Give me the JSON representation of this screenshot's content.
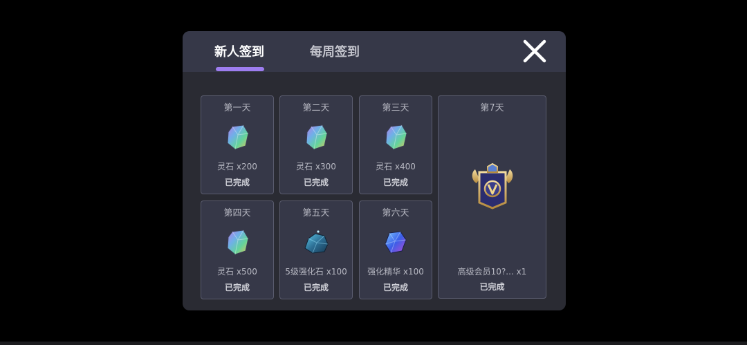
{
  "tabs": [
    {
      "label": "新人签到",
      "active": true
    },
    {
      "label": "每周签到",
      "active": false
    }
  ],
  "days": [
    {
      "title": "第一天",
      "reward": "灵石 x200",
      "status": "已完成",
      "icon": "rainbow-crystal-icon"
    },
    {
      "title": "第二天",
      "reward": "灵石 x300",
      "status": "已完成",
      "icon": "rainbow-crystal-icon"
    },
    {
      "title": "第三天",
      "reward": "灵石 x400",
      "status": "已完成",
      "icon": "rainbow-crystal-icon"
    },
    {
      "title": "第四天",
      "reward": "灵石 x500",
      "status": "已完成",
      "icon": "rainbow-crystal-icon"
    },
    {
      "title": "第五天",
      "reward": "5级强化石 x100",
      "status": "已完成",
      "icon": "enhance-stone-icon"
    },
    {
      "title": "第六天",
      "reward": "强化精华 x100",
      "status": "已完成",
      "icon": "enhance-essence-icon"
    },
    {
      "title": "第7天",
      "reward": "高级会员10?... x1",
      "status": "已完成",
      "icon": "vip-badge-icon"
    }
  ],
  "colors": {
    "accent": "#9d7df0",
    "panel": "#2a2b33",
    "header": "#363848",
    "card": "#363848"
  }
}
